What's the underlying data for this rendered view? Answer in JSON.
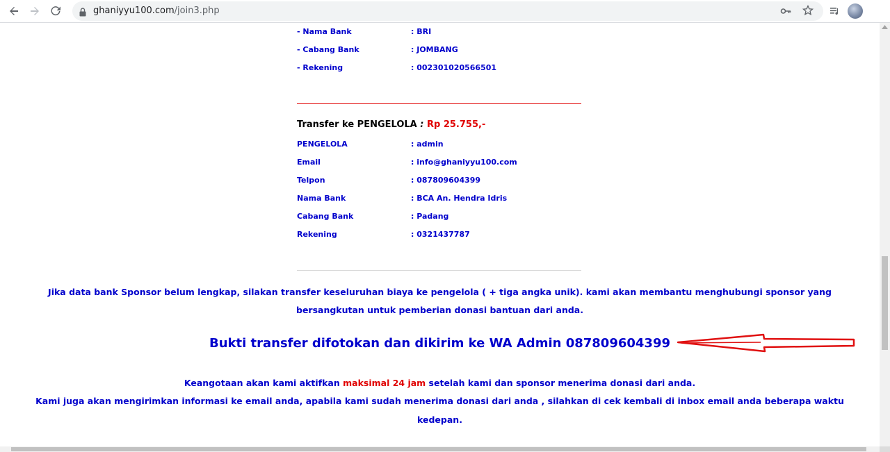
{
  "browser": {
    "url_host": "ghaniyyu100.com",
    "url_path": "/join3.php",
    "icons": [
      "back-arrow-icon",
      "forward-arrow-icon",
      "reload-icon",
      "lock-icon",
      "key-icon",
      "star-icon",
      "media-queue-icon",
      "profile-avatar"
    ]
  },
  "sponsor_bank": {
    "rows": [
      {
        "label": "- Nama Bank",
        "value": ": BRI"
      },
      {
        "label": "- Cabang Bank",
        "value": ": JOMBANG"
      },
      {
        "label": "- Rekening",
        "value": ": 002301020566501"
      }
    ]
  },
  "transfer": {
    "heading": "Transfer ke PENGELOLA",
    "separator": " : ",
    "amount": "Rp 25.755,-",
    "rows": [
      {
        "label": "PENGELOLA",
        "value": ": admin"
      },
      {
        "label": "Email",
        "value": ": info@ghaniyyu100.com"
      },
      {
        "label": "Telpon",
        "value": ": 087809604399"
      },
      {
        "label": "Nama Bank",
        "value": ": BCA An. Hendra Idris"
      },
      {
        "label": "Cabang Bank",
        "value": ": Padang"
      },
      {
        "label": "Rekening",
        "value": ": 0321437787"
      }
    ]
  },
  "notice": {
    "line1": "Jika data bank Sponsor belum lengkap, silakan transfer keseluruhan biaya ke pengelola   ( + tiga angka unik). kami akan membantu menghubungi sponsor yang",
    "line2": "bersangkutan untuk pemberian donasi bantuan dari anda."
  },
  "bukti": "Bukti transfer difotokan dan dikirim ke WA Admin 087809604399",
  "activation": {
    "pre": "Keangotaan akan kami aktifkan ",
    "highlight": "maksimal 24 jam",
    "post": " setelah kami dan sponsor menerima donasi dari anda.",
    "line2": "Kami juga akan mengirimkan informasi ke email anda, apabila kami sudah menerima donasi dari anda , silahkan di cek kembali di inbox email anda beberapa waktu",
    "line3": "kedepan."
  },
  "colors": {
    "text_blue": "#0000cc",
    "accent_red": "#e00000",
    "arrow_red": "#e01010"
  }
}
